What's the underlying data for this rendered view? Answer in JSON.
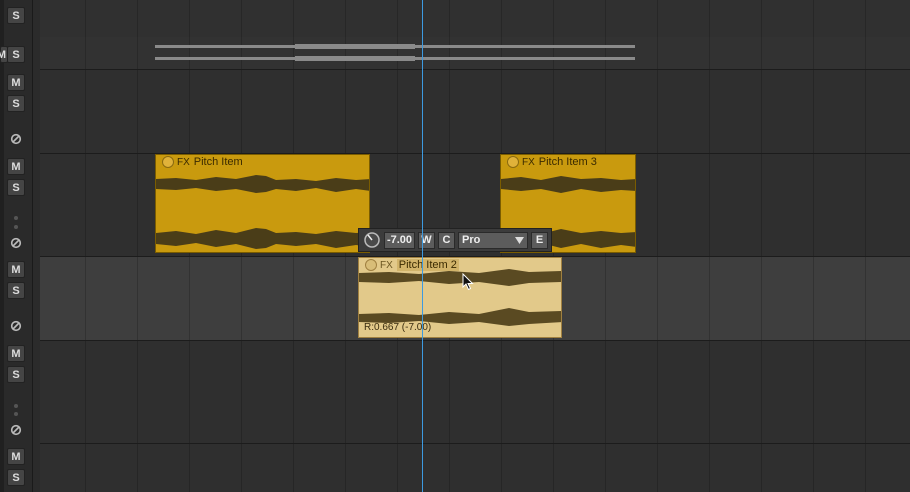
{
  "tracks": [
    {
      "mute_label": "M",
      "solo_label": "S"
    },
    {
      "mute_label": "M",
      "solo_label": "S"
    },
    {
      "mute_label": "M",
      "solo_label": "S"
    },
    {
      "mute_label": "M",
      "solo_label": "S"
    },
    {
      "mute_label": "M",
      "solo_label": "S"
    },
    {
      "mute_label": "M",
      "solo_label": "S"
    },
    {
      "mute_label": "M",
      "solo_label": "S"
    }
  ],
  "top_solo_label": "S",
  "items": {
    "pitch_item": {
      "name": "Pitch Item",
      "fx_label": "FX"
    },
    "pitch_item_3": {
      "name": "Pitch Item 3",
      "fx_label": "FX"
    },
    "pitch_item_2": {
      "name": "Pitch Item 2",
      "fx_label": "FX",
      "rate_label": "R:0.667 (-7.00)"
    }
  },
  "pitch_popup": {
    "value": "-7.00",
    "w_label": "W",
    "c_label": "C",
    "mode_value": "Pro",
    "e_label": "E"
  },
  "colors": {
    "item_yellow": "#c99a0e",
    "item_selected": "#e2c98a",
    "waveform_dark": "#4a3d18",
    "edit_cursor": "#3d9ae0"
  }
}
